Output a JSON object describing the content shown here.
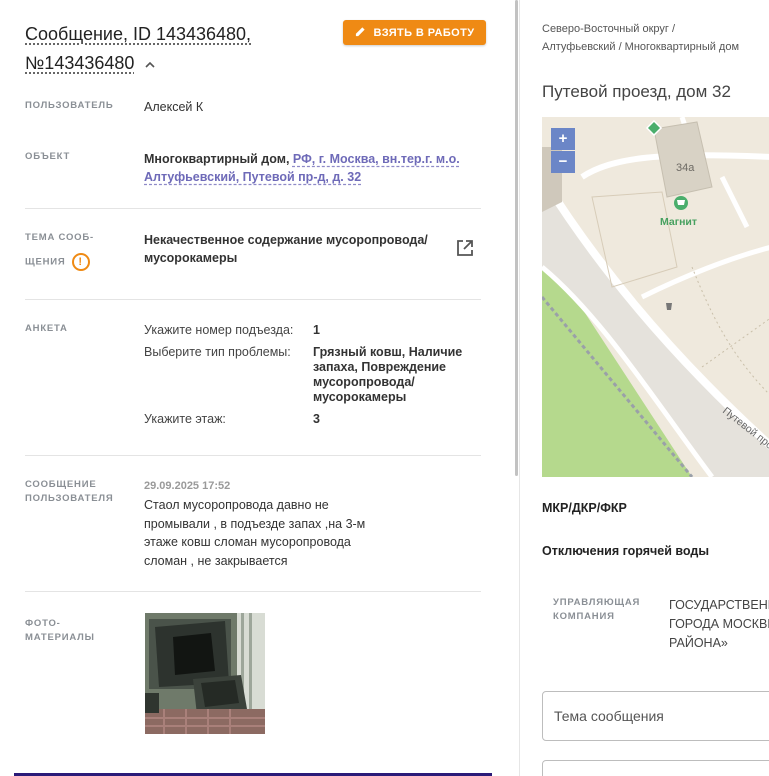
{
  "message": {
    "title_line1": "Сообщение, ID 143436480,",
    "title_line2": "№143436480",
    "take_button_label": "ВЗЯТЬ В РАБОТУ"
  },
  "rows": {
    "user_label": "ПОЛЬЗОВАТЕЛЬ",
    "user_value": "Алексей К",
    "object_label": "ОБЪЕКТ",
    "object_prefix": "Многоквартирный дом,",
    "object_link_line1": "РФ, г. Москва, вн.тер.г. м.о.",
    "object_link_line2": "Алтуфьевский, Путевой пр-д, д. 32",
    "topic_label_line1": "ТЕМА СООБ-",
    "topic_label_line2": "ЩЕНИЯ",
    "topic_value_line1": "Некачественное содержание мусоропровода/",
    "topic_value_line2": "мусорокамеры",
    "survey_label": "АНКЕТА",
    "survey": [
      {
        "q": "Укажите номер подъезда:",
        "a": [
          "1"
        ]
      },
      {
        "q": "Выберите тип проблемы:",
        "a": [
          "Грязный ковш, Наличие",
          "запаха, Повреждение",
          "мусоропровода/",
          "мусорокамеры"
        ]
      },
      {
        "q": "Укажите этаж:",
        "a": [
          "3"
        ]
      }
    ],
    "user_msg_label_line1": "СООБЩЕНИЕ",
    "user_msg_label_line2": "ПОЛЬЗОВАТЕЛЯ",
    "user_msg_date": "29.09.2025 17:52",
    "user_msg_lines": [
      "Стаол мусоропровода давно не",
      "промывали , в подъезде запах ,на 3-м",
      "этаже ковш сломан мусоропровода",
      "сломан , не закрывается"
    ],
    "photo_label_line1": "ФОТО-",
    "photo_label_line2": "МАТЕРИАЛЫ"
  },
  "right": {
    "breadcrumb_line1": "Северо-Восточный округ /",
    "breadcrumb_line2": "Алтуфьевский / Многоквартирный дом",
    "address_title": "Путевой проезд, дом 32",
    "map": {
      "zoom_in": "+",
      "zoom_out": "−",
      "building_label": "34а",
      "shop_label": "Магнит",
      "street_label": "Путевой про"
    },
    "mkr_label": "МКР/ДКР/ФКР",
    "hot_water_label": "Отключения горячей воды",
    "mc_label_line1": "УПРАВЛЯЮЩАЯ",
    "mc_label_line2": "КОМПАНИЯ",
    "mc_value_lines": [
      "ГОСУДАРСТВЕНН",
      "ГОРОДА МОСКВЫ",
      "РАЙОНА»"
    ],
    "topic_field_placeholder": "Тема сообщения"
  },
  "colors": {
    "accent_orange": "#ef8a14",
    "link_purple": "#6e6ab8",
    "map_zoom_blue": "#6b86c7",
    "bottom_bar": "#2a1a78"
  },
  "icons": [
    "pencil-icon",
    "chevron-up-icon",
    "warning-icon",
    "external-link-icon",
    "shop-cart-icon",
    "map-marker-icon"
  ]
}
